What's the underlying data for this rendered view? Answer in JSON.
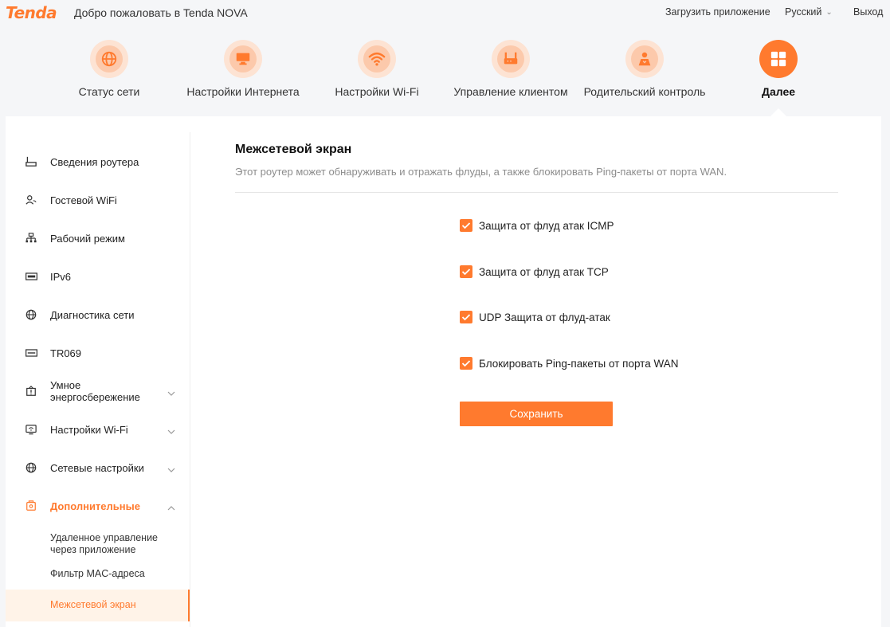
{
  "header": {
    "logo": "Tenda",
    "welcome": "Добро пожаловать в Tenda NOVA",
    "download_app": "Загрузить приложение",
    "language": "Русский",
    "logout": "Выход"
  },
  "nav": {
    "items": [
      {
        "label": "Статус сети",
        "icon": "globe-icon"
      },
      {
        "label": "Настройки Интернета",
        "icon": "monitor-icon"
      },
      {
        "label": "Настройки Wi-Fi",
        "icon": "wifi-icon"
      },
      {
        "label": "Управление клиентом",
        "icon": "router-icon"
      },
      {
        "label": "Родительский контроль",
        "icon": "parental-icon"
      },
      {
        "label": "Далее",
        "icon": "grid-icon",
        "active": true
      }
    ]
  },
  "sidebar": {
    "items": [
      {
        "label": "Сведения роутера",
        "icon": "router-info-icon"
      },
      {
        "label": "Гостевой WiFi",
        "icon": "guest-wifi-icon"
      },
      {
        "label": "Рабочий режим",
        "icon": "topology-icon"
      },
      {
        "label": "IPv6",
        "icon": "ipv6-icon"
      },
      {
        "label": "Диагностика сети",
        "icon": "globe-icon"
      },
      {
        "label": "TR069",
        "icon": "tr069-icon"
      },
      {
        "label": "Умное энергосбережение",
        "icon": "power-save-icon"
      },
      {
        "label": "Настройки Wi-Fi",
        "icon": "wifi-settings-icon"
      },
      {
        "label": "Сетевые настройки",
        "icon": "globe-icon"
      },
      {
        "label": "Дополнительные",
        "icon": "advanced-icon"
      }
    ],
    "sub_items": [
      {
        "label": "Удаленное управление через приложение"
      },
      {
        "label": "Фильтр MAC-адреса"
      },
      {
        "label": "Межсетевой экран",
        "active": true
      }
    ]
  },
  "content": {
    "title": "Межсетевой экран",
    "description": "Этот роутер может обнаруживать и отражать флуды, а также блокировать Ping-пакеты от порта WAN.",
    "options": [
      {
        "label": "Защита от флуд атак ICMP",
        "checked": true
      },
      {
        "label": "Защита от флуд атак TCP",
        "checked": true
      },
      {
        "label": "UDP Защита от флуд-атак",
        "checked": true
      },
      {
        "label": "Блокировать Ping-пакеты от порта WAN",
        "checked": true
      }
    ],
    "save_label": "Сохранить"
  },
  "colors": {
    "accent": "#ff7a2e",
    "accent_light": "#fde3d3",
    "active_bg": "#fff3e8"
  }
}
